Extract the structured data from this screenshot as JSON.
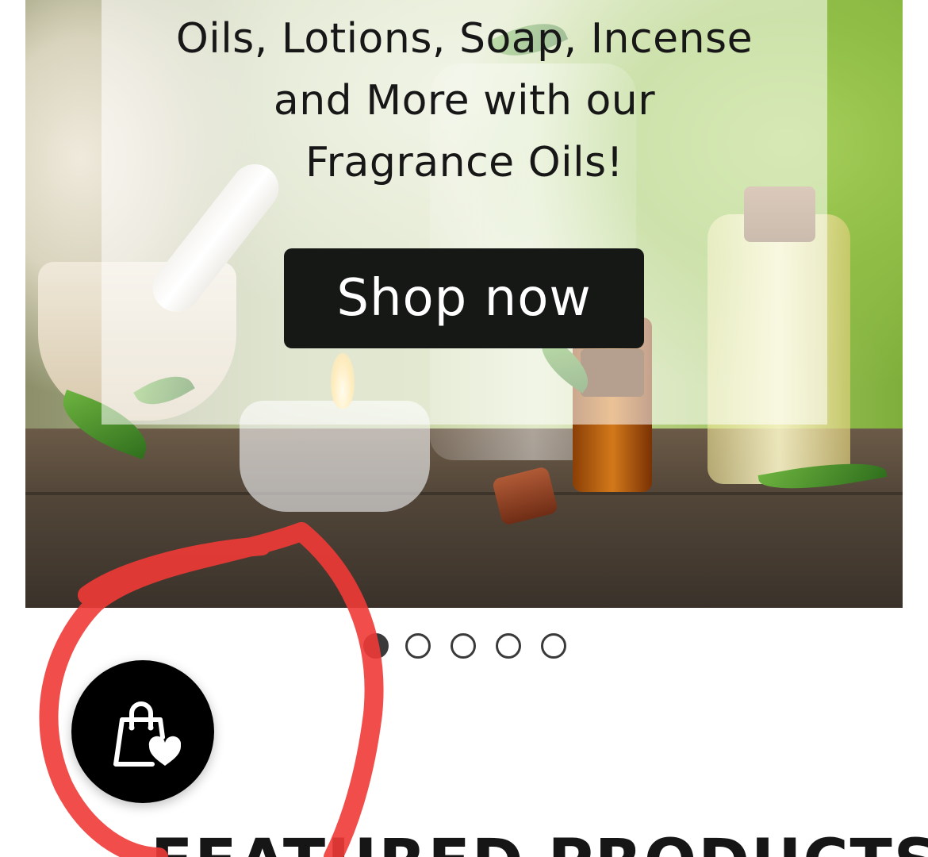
{
  "hero": {
    "lines": [
      "Oils, Lotions, Soap, Incense",
      "and More with our",
      "Fragrance Oils!"
    ],
    "cta_label": "Shop now"
  },
  "slideshow": {
    "total": 5,
    "active_index": 0
  },
  "wishlist": {
    "icon": "shopping-bag-heart-icon",
    "background": "#000000"
  },
  "section": {
    "title": "FEATURED PRODUCTS"
  },
  "annotation": {
    "color": "#f03a36"
  },
  "colors": {
    "cta_bg": "#161816",
    "dot": "#3a3a3a"
  }
}
